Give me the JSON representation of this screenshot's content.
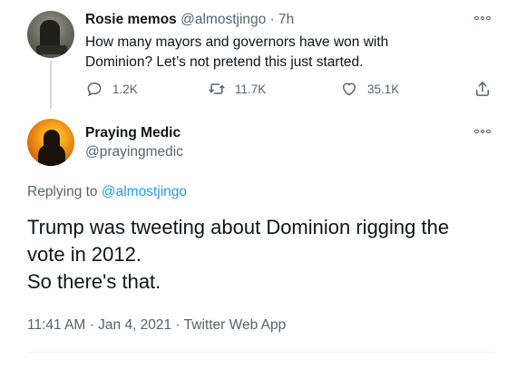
{
  "parent_tweet": {
    "author_name": "Rosie memos",
    "author_handle": "@almostjingo",
    "separator": "·",
    "time_ago": "7h",
    "text_line1": "How many mayors and governors have won with",
    "text_line2": "Dominion? Let’s not pretend this just started.",
    "reply_count": "1.2K",
    "retweet_count": "11.7K",
    "like_count": "35.1K"
  },
  "focused_tweet": {
    "author_name": "Praying Medic",
    "author_handle": "@prayingmedic",
    "replying_prefix": "Replying to",
    "replying_handle": "@almostjingo",
    "text_line1": "Trump was tweeting about Dominion rigging the",
    "text_line2": "vote in 2012.",
    "text_line3": "So there's that.",
    "time": "11:41 AM",
    "separator": "·",
    "date": "Jan 4, 2021",
    "client": "Twitter Web App"
  },
  "icons": {
    "more": "more-options-icon",
    "reply": "reply-icon",
    "retweet": "retweet-icon",
    "like": "like-icon",
    "share": "share-icon"
  },
  "colors": {
    "text": "#0f1419",
    "secondary": "#536471",
    "link": "#1d9bf0",
    "thread_line": "#cfd9de"
  }
}
